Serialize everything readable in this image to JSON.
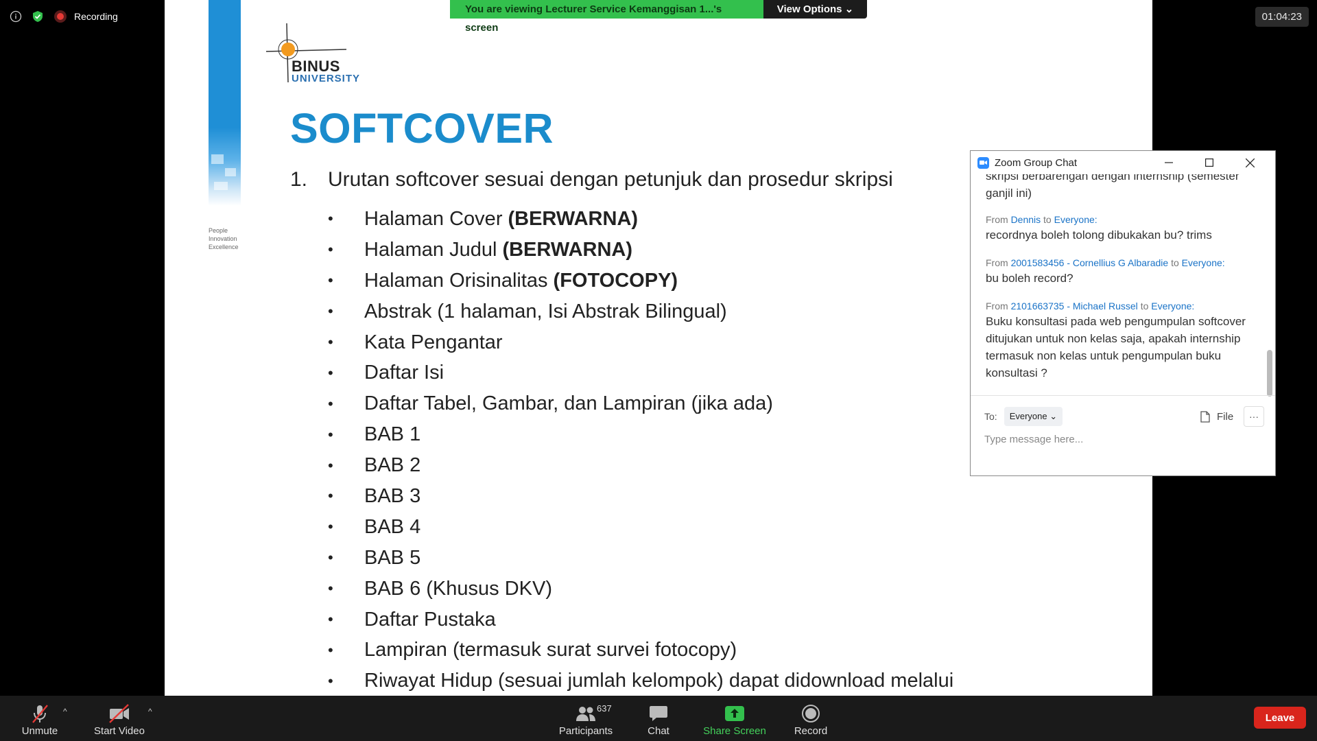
{
  "status": {
    "recording_label": "Recording",
    "timer": "01:04:23",
    "colors": {
      "shield": "#33c04d",
      "record": "#e53935"
    }
  },
  "banner": {
    "message": "You are viewing Lecturer Service Kemanggisan 1...'s screen",
    "view_options": "View Options"
  },
  "slide": {
    "logo_line1": "BINUS",
    "logo_line2": "UNIVERSITY",
    "tagline": [
      "People",
      "Innovation",
      "Excellence"
    ],
    "title": "SOFTCOVER",
    "numbered_number": "1.",
    "numbered_text": "Urutan softcover sesuai dengan petunjuk dan prosedur skripsi",
    "bullets": [
      {
        "text": "Halaman Cover",
        "bold": "(BERWARNA)"
      },
      {
        "text": "Halaman Judul",
        "bold": "(BERWARNA)"
      },
      {
        "text": "Halaman Orisinalitas",
        "bold": "(FOTOCOPY)"
      },
      {
        "text": "Abstrak (1 halaman, Isi Abstrak Bilingual)",
        "bold": ""
      },
      {
        "text": "Kata Pengantar",
        "bold": ""
      },
      {
        "text": "Daftar Isi",
        "bold": ""
      },
      {
        "text": "Daftar Tabel, Gambar, dan Lampiran (jika ada)",
        "bold": ""
      },
      {
        "text": "BAB 1",
        "bold": ""
      },
      {
        "text": "BAB 2",
        "bold": ""
      },
      {
        "text": "BAB 3",
        "bold": ""
      },
      {
        "text": "BAB 4",
        "bold": ""
      },
      {
        "text": "BAB 5",
        "bold": ""
      },
      {
        "text": "BAB 6 (Khusus DKV)",
        "bold": ""
      },
      {
        "text": "Daftar Pustaka",
        "bold": ""
      },
      {
        "text": "Lampiran (termasuk surat survei fotocopy)",
        "bold": ""
      },
      {
        "text": "Riwayat Hidup (sesuai jumlah kelompok) dapat didownload melalui",
        "bold": ""
      }
    ],
    "colors": {
      "title": "#1b8ccc",
      "strip": "#1f8fd6"
    }
  },
  "chat": {
    "title": "Zoom Group Chat",
    "messages": [
      {
        "from_prefix": "",
        "sender": "",
        "to_word": "",
        "recipient": "",
        "body": "skripsi berbarengan dengan internship (semester ganjil ini)"
      },
      {
        "from_prefix": "From",
        "sender": "Dennis",
        "to_word": "to",
        "recipient": "Everyone:",
        "body": "recordnya boleh tolong dibukakan bu? trims"
      },
      {
        "from_prefix": "From",
        "sender": "2001583456 - Cornellius G Albaradie",
        "to_word": "to",
        "recipient": "Everyone:",
        "body": "bu boleh record?"
      },
      {
        "from_prefix": "From",
        "sender": "2101663735 - Michael Russel",
        "to_word": "to",
        "recipient": "Everyone:",
        "body": "Buku konsultasi pada web pengumpulan softcover ditujukan untuk non kelas saja, apakah internship termasuk non kelas untuk pengumpulan buku konsultasi ?"
      }
    ],
    "to_label": "To:",
    "to_value": "Everyone",
    "file_label": "File",
    "more_label": "···",
    "input_placeholder": "Type message here..."
  },
  "toolbar": {
    "unmute": "Unmute",
    "start_video": "Start Video",
    "participants": "Participants",
    "participants_count": "637",
    "chat": "Chat",
    "share_screen": "Share Screen",
    "record": "Record",
    "leave": "Leave",
    "colors": {
      "share": "#44d15b",
      "leave": "#d9251c",
      "muted": "#e53935"
    }
  }
}
